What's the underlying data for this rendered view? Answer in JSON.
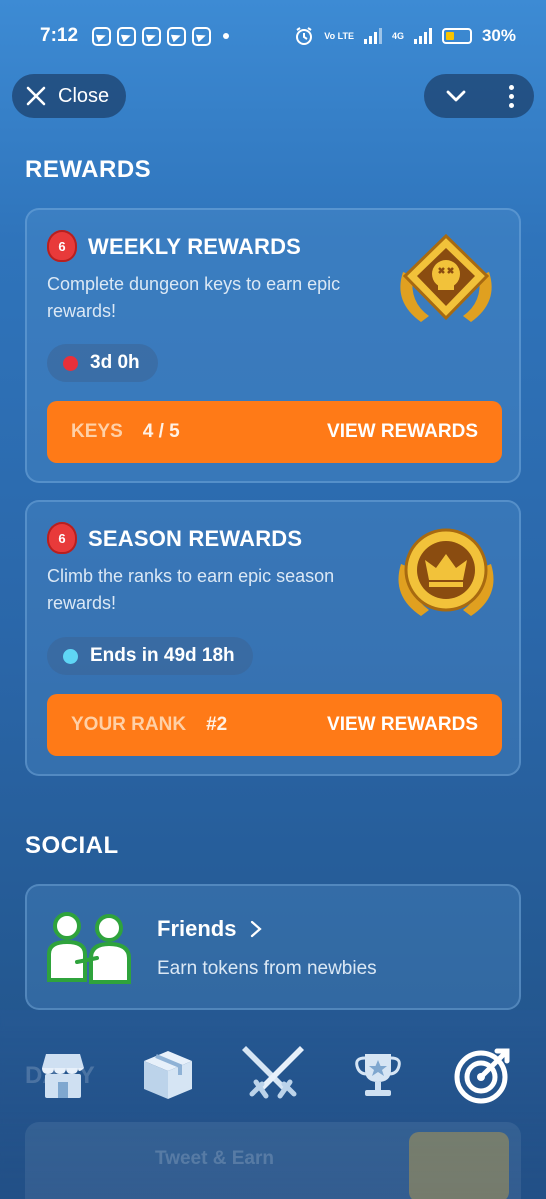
{
  "status_bar": {
    "time": "7:12",
    "network_label": "Vo LTE",
    "network_type": "4G",
    "battery": "30%"
  },
  "topbar": {
    "close_label": "Close"
  },
  "rewards_section": {
    "title": "REWARDS",
    "weekly": {
      "badge": "6",
      "title": "WEEKLY REWARDS",
      "description": "Complete dungeon keys to earn epic rewards!",
      "timer": "3d 0h",
      "timer_color": "#e8303a",
      "keys_label": "KEYS",
      "keys_value": "4 / 5",
      "cta_label": "VIEW REWARDS"
    },
    "season": {
      "badge": "6",
      "title": "SEASON REWARDS",
      "description": "Climb the ranks to earn epic season rewards!",
      "timer": "Ends in 49d 18h",
      "timer_color": "#5fd6f5",
      "rank_label": "YOUR RANK",
      "rank_value": "#2",
      "cta_label": "VIEW REWARDS"
    }
  },
  "social_section": {
    "title": "SOCIAL",
    "friends": {
      "title": "Friends",
      "subtitle": "Earn tokens from newbies",
      "icon": "friends-icon"
    }
  },
  "bottom_nav": {
    "items": [
      {
        "name": "shop",
        "icon": "store-icon"
      },
      {
        "name": "inventory",
        "icon": "box-icon"
      },
      {
        "name": "battle",
        "icon": "crossed-swords-icon"
      },
      {
        "name": "leaderboard",
        "icon": "trophy-icon"
      },
      {
        "name": "quests",
        "icon": "target-icon"
      }
    ]
  },
  "background_ghost": {
    "heading": "DAILY",
    "item": "Tweet & Earn"
  },
  "colors": {
    "accent": "#ff7a17",
    "badge": "#e83a3a",
    "gold": "#f2b52b"
  }
}
